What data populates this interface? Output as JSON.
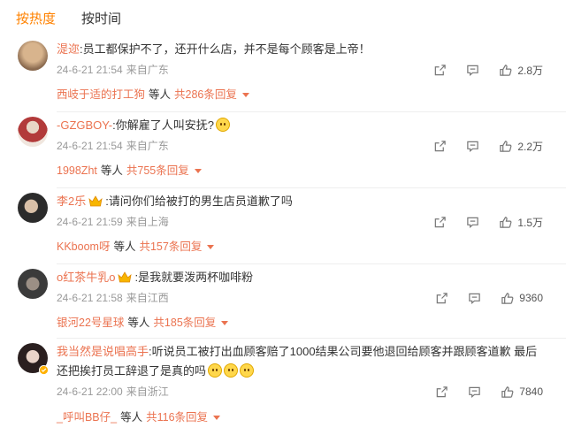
{
  "tabs": {
    "hot": "按热度",
    "time": "按时间"
  },
  "comments": [
    {
      "user": "湜迩",
      "text": ":员工都保护不了，还开什么店，并不是每个顾客是上帝！",
      "time": "24-6-21 21:54",
      "source": "来自广东",
      "likes": "2.8万",
      "reply_user": "西岐于适的打工狗",
      "reply_mid": "等人",
      "reply_more": "共286条回复",
      "avatar_colors": [
        "#c9a27a",
        "#8a6a4f"
      ]
    },
    {
      "user": "-GZGBOY-",
      "text": ":你解雇了人叫安抚?",
      "time": "24-6-21 21:54",
      "source": "来自广东",
      "likes": "2.2万",
      "reply_user": "1998Zht",
      "reply_mid": "等人",
      "reply_more": "共755条回复",
      "avatar_colors": [
        "#b23a3a",
        "#e8d6c6"
      ]
    },
    {
      "user": "李2乐",
      "text": ":请问你们给被打的男生店员道歉了吗",
      "time": "24-6-21 21:59",
      "source": "来自上海",
      "likes": "1.5万",
      "reply_user": "KKboom呀",
      "reply_mid": "等人",
      "reply_more": "共157条回复",
      "avatar_colors": [
        "#2b2b2b",
        "#d9c0a8"
      ]
    },
    {
      "user": "o红茶牛乳o",
      "text": ":是我就要泼两杯咖啡粉",
      "time": "24-6-21 21:58",
      "source": "来自江西",
      "likes": "9360",
      "reply_user": "银河22号星球",
      "reply_mid": "等人",
      "reply_more": "共185条回复",
      "avatar_colors": [
        "#3b3b3b",
        "#9b8f85"
      ]
    },
    {
      "user": "我当然是说唱高手",
      "text": ":听说员工被打出血顾客赔了1000结果公司要他退回给顾客并跟顾客道歉 最后还把挨打员工辞退了是真的吗",
      "time": "24-6-21 22:00",
      "source": "来自浙江",
      "likes": "7840",
      "reply_user": "_呼叫BB仔_",
      "reply_mid": "等人",
      "reply_more": "共116条回复",
      "avatar_colors": [
        "#e9d3c8",
        "#2a1f1f"
      ]
    }
  ],
  "colors": {
    "accent": "#ff8200",
    "link": "#eb7350",
    "meta": "#999999"
  },
  "icons": {
    "share": "share-icon",
    "comment": "comment-icon",
    "like": "thumbs-up-icon"
  }
}
